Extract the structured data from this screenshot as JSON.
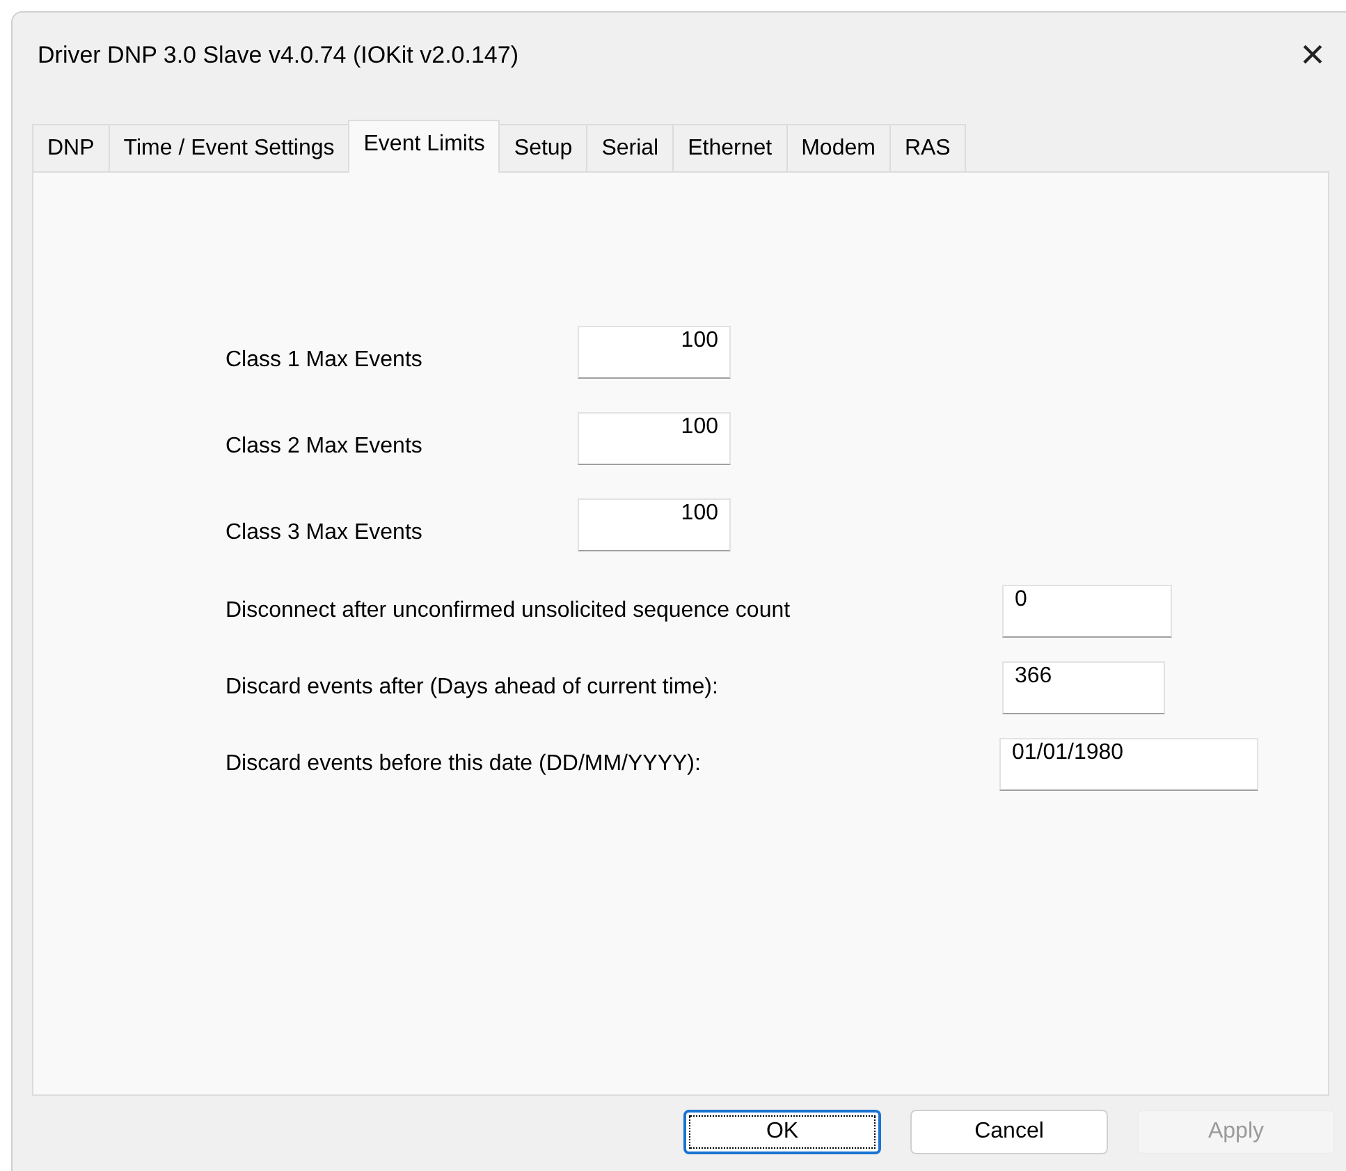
{
  "window": {
    "title": "Driver DNP 3.0 Slave v4.0.74 (IOKit v2.0.147)",
    "close": "×"
  },
  "tabs": [
    {
      "label": "DNP",
      "selected": false
    },
    {
      "label": "Time / Event Settings",
      "selected": false
    },
    {
      "label": "Event Limits",
      "selected": true
    },
    {
      "label": "Setup",
      "selected": false
    },
    {
      "label": "Serial",
      "selected": false
    },
    {
      "label": "Ethernet",
      "selected": false
    },
    {
      "label": "Modem",
      "selected": false
    },
    {
      "label": "RAS",
      "selected": false
    }
  ],
  "fields": [
    {
      "kind": "count",
      "label": "Class 1 Max Events",
      "value": "100"
    },
    {
      "kind": "count",
      "label": "Class 2 Max Events",
      "value": "100"
    },
    {
      "kind": "count",
      "label": "Class 3 Max Events",
      "value": "100"
    },
    {
      "kind": "number",
      "label": "Disconnect after unconfirmed unsolicited sequence count",
      "value": "0"
    },
    {
      "kind": "days",
      "label": "Discard events after (Days ahead of current time):",
      "value": "366"
    },
    {
      "kind": "date",
      "label": "Discard events before this date (DD/MM/YYYY):",
      "value": "01/01/1980"
    }
  ],
  "buttons": [
    {
      "label": "OK",
      "default": true,
      "disabled": false
    },
    {
      "label": "Cancel",
      "default": false,
      "disabled": false
    },
    {
      "label": "Apply",
      "default": false,
      "disabled": true
    }
  ]
}
